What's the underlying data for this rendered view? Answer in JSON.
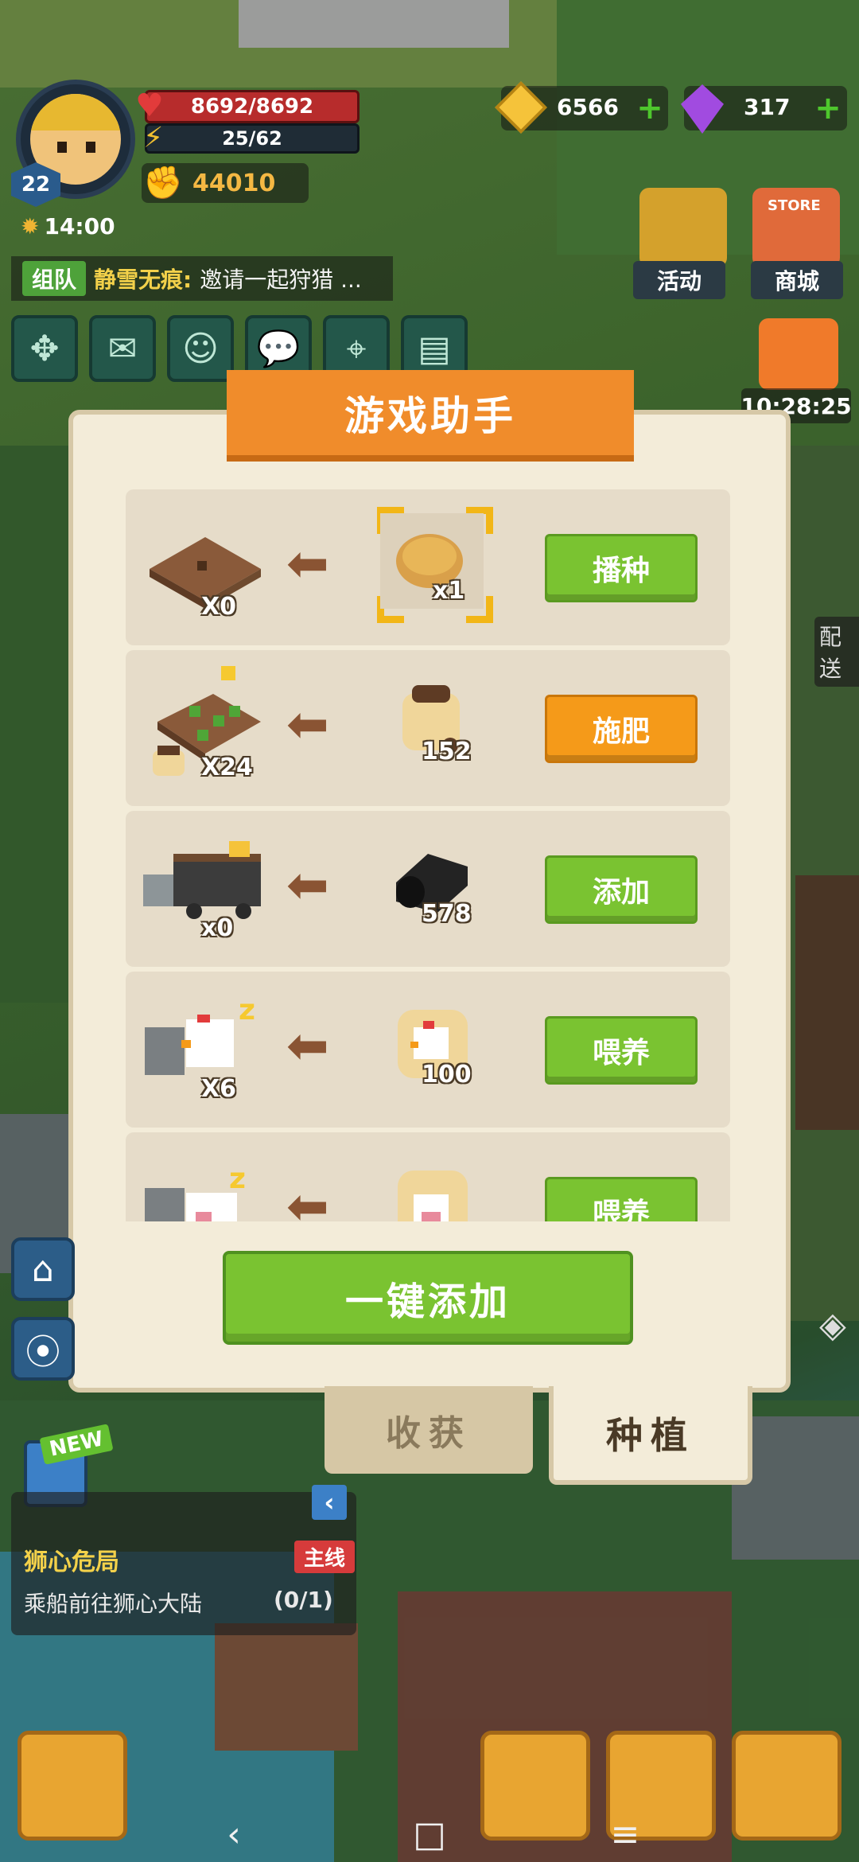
{
  "player": {
    "level": "22",
    "hp": "8692/8692",
    "xp": "25/62",
    "power": "44010",
    "time": "14:00"
  },
  "resources": {
    "gold": "6566",
    "gems": "317"
  },
  "chat": {
    "channel": "组队",
    "sender": "静雪无痕:",
    "message": "邀请一起狩猎 ..."
  },
  "top_buttons": {
    "activity": "活动",
    "store": "商城",
    "store_sign": "STORE",
    "timer": "10:28:25"
  },
  "side_label": "配送",
  "dialog": {
    "title": "游戏助手",
    "rows": [
      {
        "target_qty": "X0",
        "resource_qty": "x1",
        "button": "播种",
        "style": "green"
      },
      {
        "target_qty": "X24",
        "resource_qty": "152",
        "button": "施肥",
        "style": "orange"
      },
      {
        "target_qty": "x0",
        "resource_qty": "578",
        "button": "添加",
        "style": "green"
      },
      {
        "target_qty": "X6",
        "resource_qty": "100",
        "button": "喂养",
        "style": "green"
      },
      {
        "target_qty": "",
        "resource_qty": "",
        "button": "喂养",
        "style": "green"
      }
    ],
    "one_key_button": "一键添加",
    "tabs": {
      "harvest": "收获",
      "plant": "种植"
    }
  },
  "quest": {
    "new_badge": "NEW",
    "title": "狮心危局",
    "tag": "主线",
    "description": "乘船前往狮心大陆",
    "progress": "(0/1)"
  },
  "navigation": {
    "back": "‹",
    "home": "□",
    "menu": "≡"
  },
  "colors": {
    "accent_orange": "#f08c2b",
    "button_green": "#7ac331",
    "button_orange": "#f59a19",
    "dialog_bg": "#f3ecd9"
  }
}
